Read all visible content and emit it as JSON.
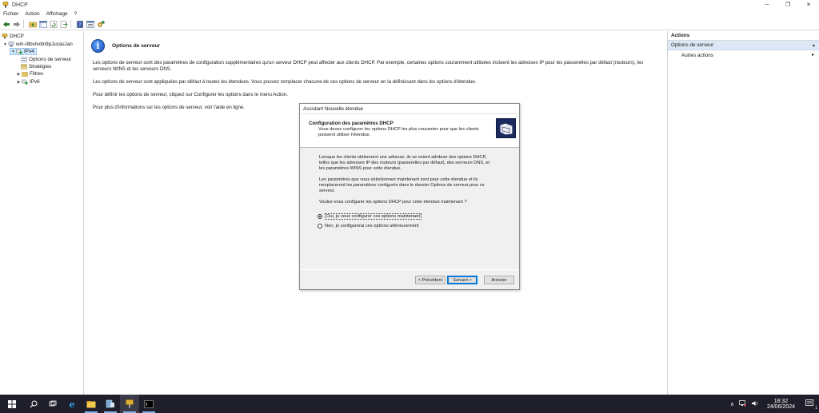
{
  "window": {
    "title": "DHCP",
    "controls": {
      "minimize": "─",
      "maximize": "❐",
      "close": "✕"
    }
  },
  "menu": [
    "Fichier",
    "Action",
    "Affichage",
    "?"
  ],
  "tree": {
    "root": "DHCP",
    "server": "win-r8bvtvdin9pJucasJan",
    "ipv4": "IPv4",
    "server_options": "Options de serveur",
    "policies": "Stratégies",
    "filters": "Filtres",
    "ipv6": "IPv6"
  },
  "main": {
    "title": "Options de serveur",
    "paragraphs": [
      "Les options de serveur sont des paramètres de configuration supplémentaires qu'un serveur DHCP peut affecter aux clients DHCP. Par exemple, certaines options couramment utilisées incluent les adresses IP pour les passerelles par défaut (routeurs), les serveurs WINS et les serveurs DNS.",
      "Les options de serveur sont appliquées par défaut à toutes les étendues. Vous pouvez remplacer chacune de ces options de serveur en la définissant dans les options d'étendue.",
      "Pour définir les options de serveur, cliquez sur Configurer les options dans le menu Action.",
      "Pour plus d'informations sur les options de serveur, voir l'aide en ligne."
    ]
  },
  "wizard": {
    "title": "Assistant Nouvelle étendue",
    "heading": "Configuration des paramètres DHCP",
    "subheading": "Vous devez configurer les options DHCP les plus courantes pour que les clients puissent utiliser l'étendue.",
    "body": [
      "Lorsque les clients obtiennent une adresse, ils se voient attribuer des options DHCP, telles que les adresses IP des routeurs (passerelles par défaut), des serveurs DNS, et les paramètres WINS pour cette étendue.",
      "Les paramètres que vous sélectionnez maintenant sont pour cette étendue et ils remplaceront les paramètres configurés dans le dossier Options de serveur pour ce serveur.",
      "Voulez-vous configurer les options DHCP pour cette étendue maintenant ?"
    ],
    "option_yes": "Oui, je veux configurer ces options maintenant",
    "option_no": "Non, je configurerai ces options ultérieurement",
    "selected": "yes",
    "buttons": {
      "back": "< Précédent",
      "next": "Suivant >",
      "cancel": "Annuler"
    }
  },
  "actions": {
    "header": "Actions",
    "section": "Options de serveur",
    "items": [
      "Autres actions"
    ]
  },
  "taskbar": {
    "time": "18:32",
    "date": "24/06/2024",
    "tray_up": "∧",
    "notif_count": "1"
  },
  "colors": {
    "accent": "#0078d7",
    "selection": "#cce8ff",
    "taskbar": "#1f1f2b",
    "actions_section": "#dce8f5"
  }
}
